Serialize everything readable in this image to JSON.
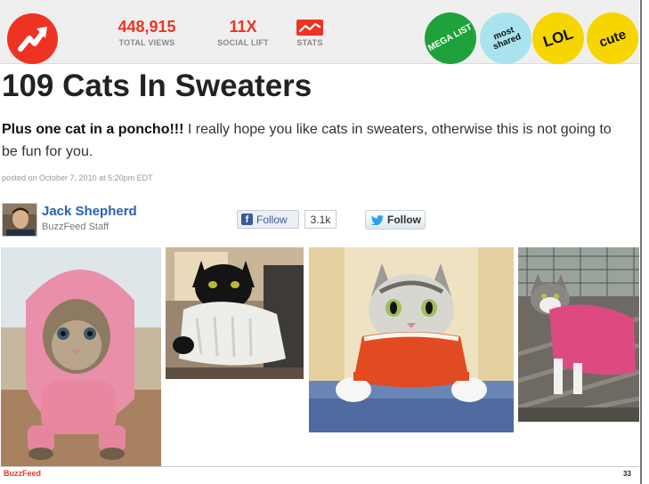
{
  "stats": {
    "views_value": "448,915",
    "views_label": "TOTAL VIEWS",
    "lift_value": "11X",
    "lift_label": "SOCIAL LIFT",
    "stats_label": "STATS"
  },
  "badges": {
    "mega": "MEGA LIST",
    "most": "most shared",
    "lol": "LOL",
    "cute": "cute"
  },
  "article": {
    "title": "109 Cats In Sweaters",
    "dek_bold": "Plus one cat in a poncho!!!",
    "dek_rest": " I really hope you like cats in sweaters, otherwise this is not going to be fun for you.",
    "posted": "posted on October 7, 2010 at 5:20pm EDT"
  },
  "author": {
    "name": "Jack Shepherd",
    "role": "BuzzFeed Staff"
  },
  "social": {
    "fb_follow": "Follow",
    "fb_count": "3.1k",
    "tw_follow": "Follow"
  },
  "photos": [
    {
      "icon": "cat-pink-hoodie-photo"
    },
    {
      "icon": "black-cat-white-sweater-photo"
    },
    {
      "icon": "tabby-cat-red-sweater-photo"
    },
    {
      "icon": "cat-pink-sweater-deck-photo"
    }
  ],
  "footer": {
    "brand": "BuzzFeed",
    "page": "33"
  },
  "colors": {
    "brand_red": "#ee3322",
    "link_blue": "#2a62b4",
    "mega_green": "#1fa23c",
    "most_cyan": "#a9e4ee",
    "lol_yellow": "#f6d500"
  }
}
